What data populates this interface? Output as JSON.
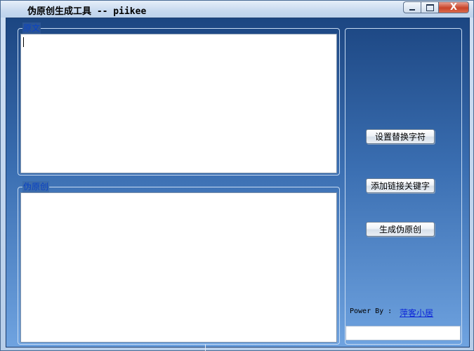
{
  "window": {
    "title": "伪原创生成工具 -- piikee",
    "controls": {
      "minimize": "",
      "maximize": "",
      "close": "X"
    }
  },
  "source_group": {
    "label": "原文",
    "text": ""
  },
  "output_group": {
    "label": "伪原创",
    "text": ""
  },
  "buttons": {
    "set_replace": "设置替换字符",
    "add_link_keyword": "添加链接关键字",
    "generate": "生成伪原创"
  },
  "footer": {
    "power_by": "Power By :",
    "author_link": "萍客小居",
    "status_text": ""
  },
  "colors": {
    "panel_top": "#1c4682",
    "panel_bottom": "#6fa3e0",
    "group_label": "#0b43c4",
    "link": "#0b24d8"
  }
}
